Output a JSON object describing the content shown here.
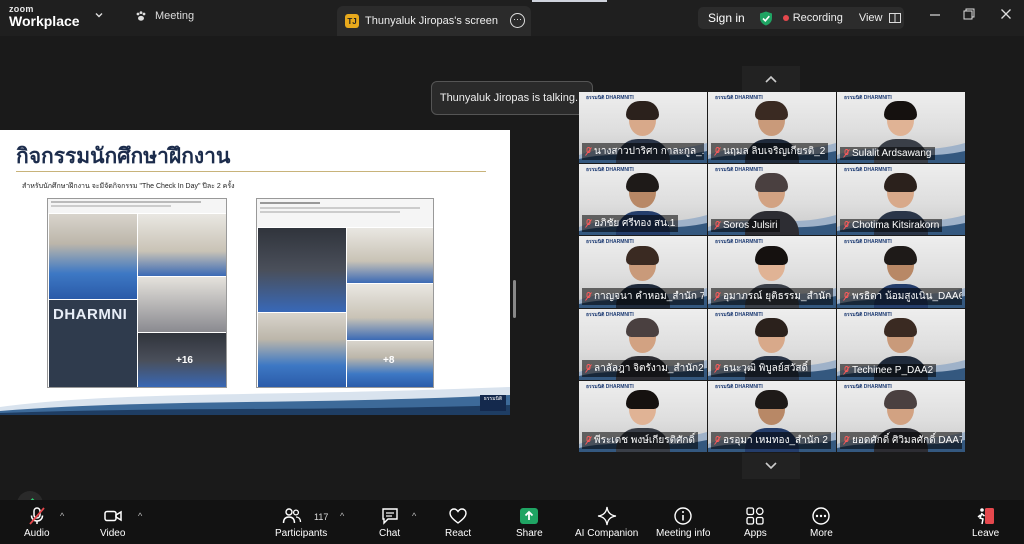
{
  "titlebar": {
    "logo_top": "zoom",
    "logo_bottom": "Workplace",
    "meeting_label": "Meeting",
    "share_tab": "Thunyaluk Jiropas's screen",
    "share_tab_initial": "TJ",
    "sign_in": "Sign in",
    "recording": "Recording",
    "view": "View"
  },
  "tooltip": "Thunyaluk Jiropas is talking...",
  "slide": {
    "title": "กิจกรรมนักศึกษาฝึกงาน",
    "bullet": "สำหรับนักศึกษาฝึกงาน จะมีจัดกิจกรรม \"The Check In Day\" ปีละ 2 ครั้ง",
    "post_left_plus": "+16",
    "post_right_plus": "+8",
    "banner_text": "DHARMNI",
    "logo_text": "ธรรมนิติ"
  },
  "gallery": {
    "brand": "ธรรมนิติ DHARMNITI",
    "participants": [
      {
        "name": "นางสาวปาริศา กาละกูล_..."
      },
      {
        "name": "นฤมล ลิบเจริญเกียรติ_2"
      },
      {
        "name": "Sulalit Ardsawang"
      },
      {
        "name": "อภิชัย ศรีทอง สน.1"
      },
      {
        "name": "Soros Julsiri"
      },
      {
        "name": "Chotima Kitsirakorn"
      },
      {
        "name": "กาญจนา คำหอม_สำนัก 7"
      },
      {
        "name": "อุมาภรณ์ ยุติธรรม_สำนัก 3"
      },
      {
        "name": "พรธิดา น้อมสูงเนิน_DAA6"
      },
      {
        "name": "ลาลัลฎา จิตรังาม_สำนัก2"
      },
      {
        "name": "ธนะวุฒิ พิบูลย์สวัสดิ์"
      },
      {
        "name": "Techinee P_DAA2"
      },
      {
        "name": "พีระเดช พงษ์เกียรติศักดิ์"
      },
      {
        "name": "อรอุมา เหมทอง_สำนัก 2"
      },
      {
        "name": "ยอดศักดิ์ ศิวิมลศักดิ์ DAA7"
      }
    ]
  },
  "toolbar": {
    "audio": "Audio",
    "video": "Video",
    "participants": "Participants",
    "participant_count": "117",
    "chat": "Chat",
    "react": "React",
    "share": "Share",
    "ai": "AI Companion",
    "info": "Meeting info",
    "apps": "Apps",
    "more": "More",
    "leave": "Leave"
  },
  "colors": {
    "share_green": "#1fa463",
    "leave_red": "#e5484d",
    "shield_green": "#1fa463",
    "slide_title_navy": "#1c2c4c"
  }
}
